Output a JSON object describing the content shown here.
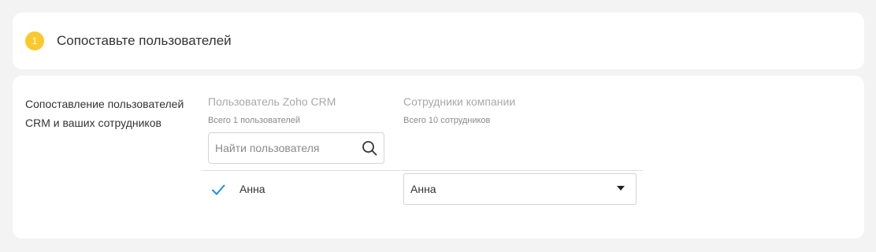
{
  "header": {
    "step_number": "1",
    "title": "Сопоставьте пользователей"
  },
  "mapping": {
    "description_line1": "Сопоставление пользователей",
    "description_line2": "CRM и ваших сотрудников",
    "crm_column": {
      "title": "Пользователь Zoho CRM",
      "subtitle": "Всего 1 пользователей"
    },
    "employees_column": {
      "title": "Сотрудники компании",
      "subtitle": "Всего 10 сотрудников"
    },
    "search": {
      "placeholder": "Найти пользователя",
      "value": ""
    },
    "rows": [
      {
        "crm_user": "Анна",
        "checked": true,
        "selected_employee": "Анна"
      }
    ]
  },
  "colors": {
    "badge": "#fcc82c",
    "check": "#1a8fe3",
    "page_background": "#f2f3f2"
  },
  "icons": [
    "search-icon",
    "check-icon",
    "caret-down-icon"
  ]
}
